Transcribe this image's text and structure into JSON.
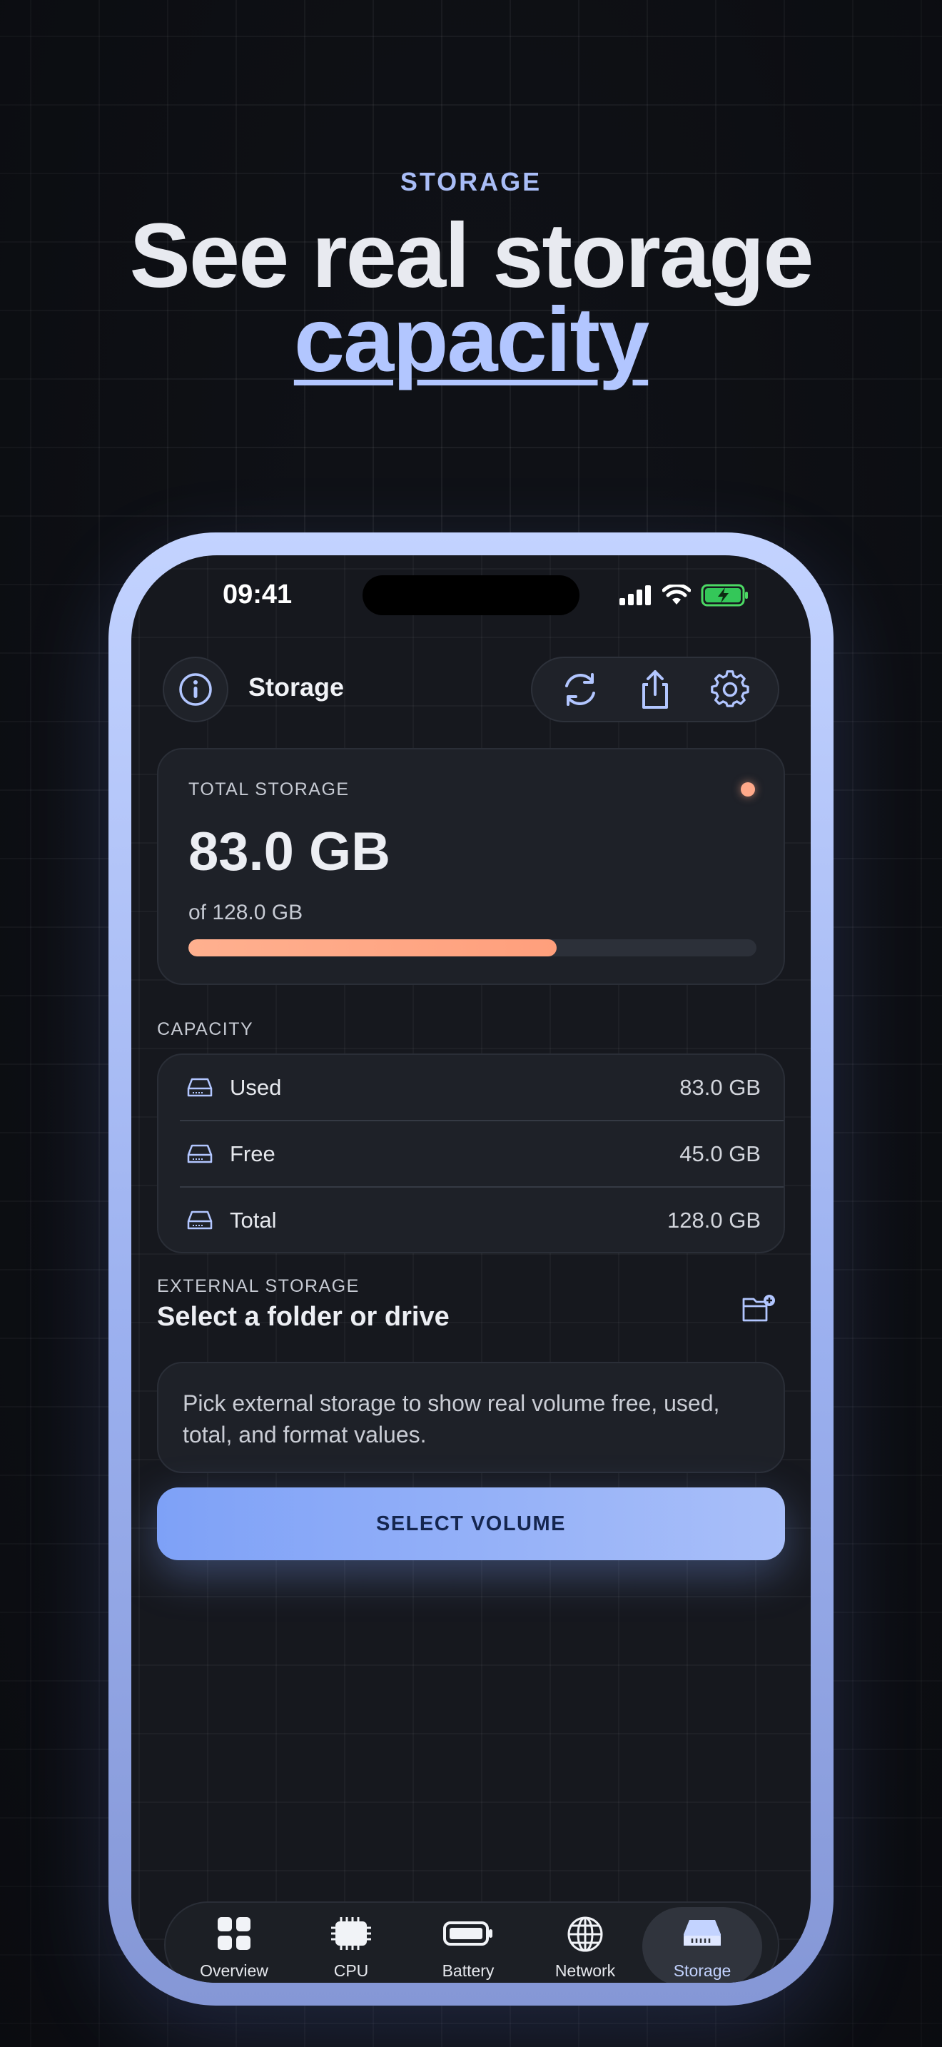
{
  "marketing": {
    "eyebrow": "STORAGE",
    "headline_line1": "See real storage",
    "headline_accent": "capacity"
  },
  "status_bar": {
    "time": "09:41"
  },
  "header": {
    "title": "Storage",
    "info_icon": "info-icon",
    "actions": [
      "refresh-icon",
      "share-icon",
      "gear-icon"
    ]
  },
  "total_storage": {
    "label": "TOTAL STORAGE",
    "value": "83.0 GB",
    "of_text": "of 128.0 GB",
    "used_fraction": 0.648,
    "indicator_color": "#ffa98a"
  },
  "capacity": {
    "label": "CAPACITY",
    "rows": [
      {
        "name": "Used",
        "value": "83.0 GB"
      },
      {
        "name": "Free",
        "value": "45.0 GB"
      },
      {
        "name": "Total",
        "value": "128.0 GB"
      }
    ]
  },
  "external": {
    "label": "EXTERNAL STORAGE",
    "title": "Select a folder or drive",
    "description": "Pick external storage to show real volume free, used, total, and format values.",
    "button": "SELECT VOLUME"
  },
  "tabs": [
    {
      "label": "Overview",
      "icon": "grid-icon",
      "active": false
    },
    {
      "label": "CPU",
      "icon": "chip-icon",
      "active": false
    },
    {
      "label": "Battery",
      "icon": "battery-icon",
      "active": false
    },
    {
      "label": "Network",
      "icon": "globe-icon",
      "active": false
    },
    {
      "label": "Storage",
      "icon": "drive-icon",
      "active": true
    }
  ],
  "colors": {
    "accent": "#b2c6ff",
    "progress": "#ffa98a",
    "button_start": "#7ea1f7",
    "button_end": "#a9bff9"
  }
}
